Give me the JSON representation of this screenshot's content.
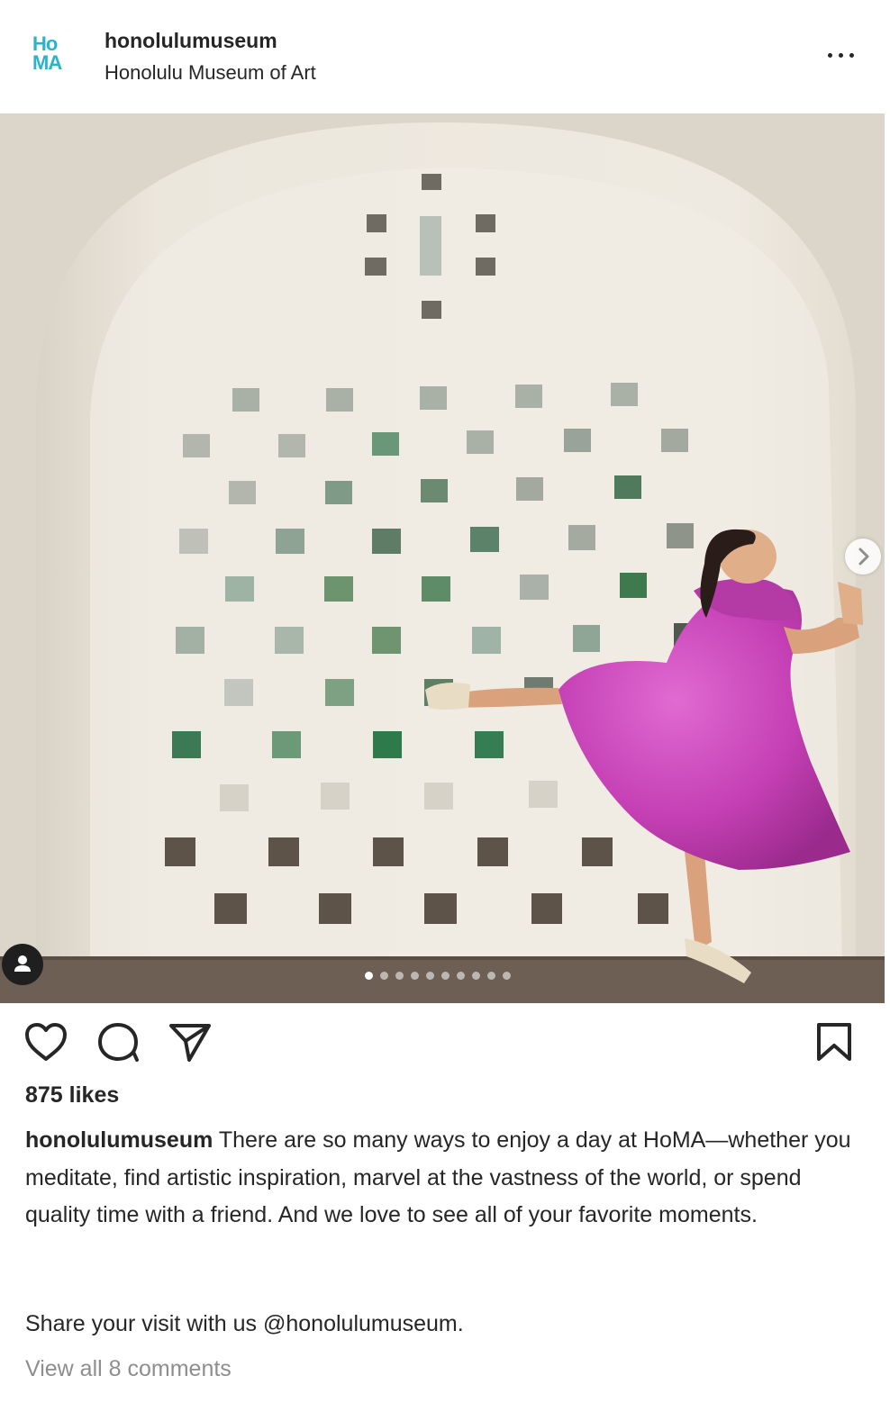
{
  "post": {
    "username": "honolulumuseum",
    "location": "Honolulu Museum of Art",
    "logo_lines": [
      "Ho",
      "MA"
    ],
    "media": {
      "carousel_count": 10,
      "carousel_active_index": 0,
      "description_icons": [
        "next-arrow-icon",
        "user-tag-icon"
      ]
    },
    "likes": "875 likes",
    "caption_user": "honolulumuseum",
    "caption_text": "There are so many ways to enjoy a day at HoMA—whether you meditate, find artistic inspiration, marvel at the vastness of the world, or spend quality time with a friend. And we love to see all of your favorite moments.",
    "share_text": "Share your visit with us @honolulumuseum.",
    "view_comments": "View all 8 comments"
  },
  "icons": {
    "more": "more-options-icon",
    "like": "heart-icon",
    "comment": "comment-icon",
    "share": "share-icon",
    "save": "bookmark-icon"
  },
  "colors": {
    "brand": "#2bb3c9",
    "text": "#262626",
    "muted": "#8e8e8e",
    "dress": "#c43fb4",
    "wall": "#ede8de"
  }
}
